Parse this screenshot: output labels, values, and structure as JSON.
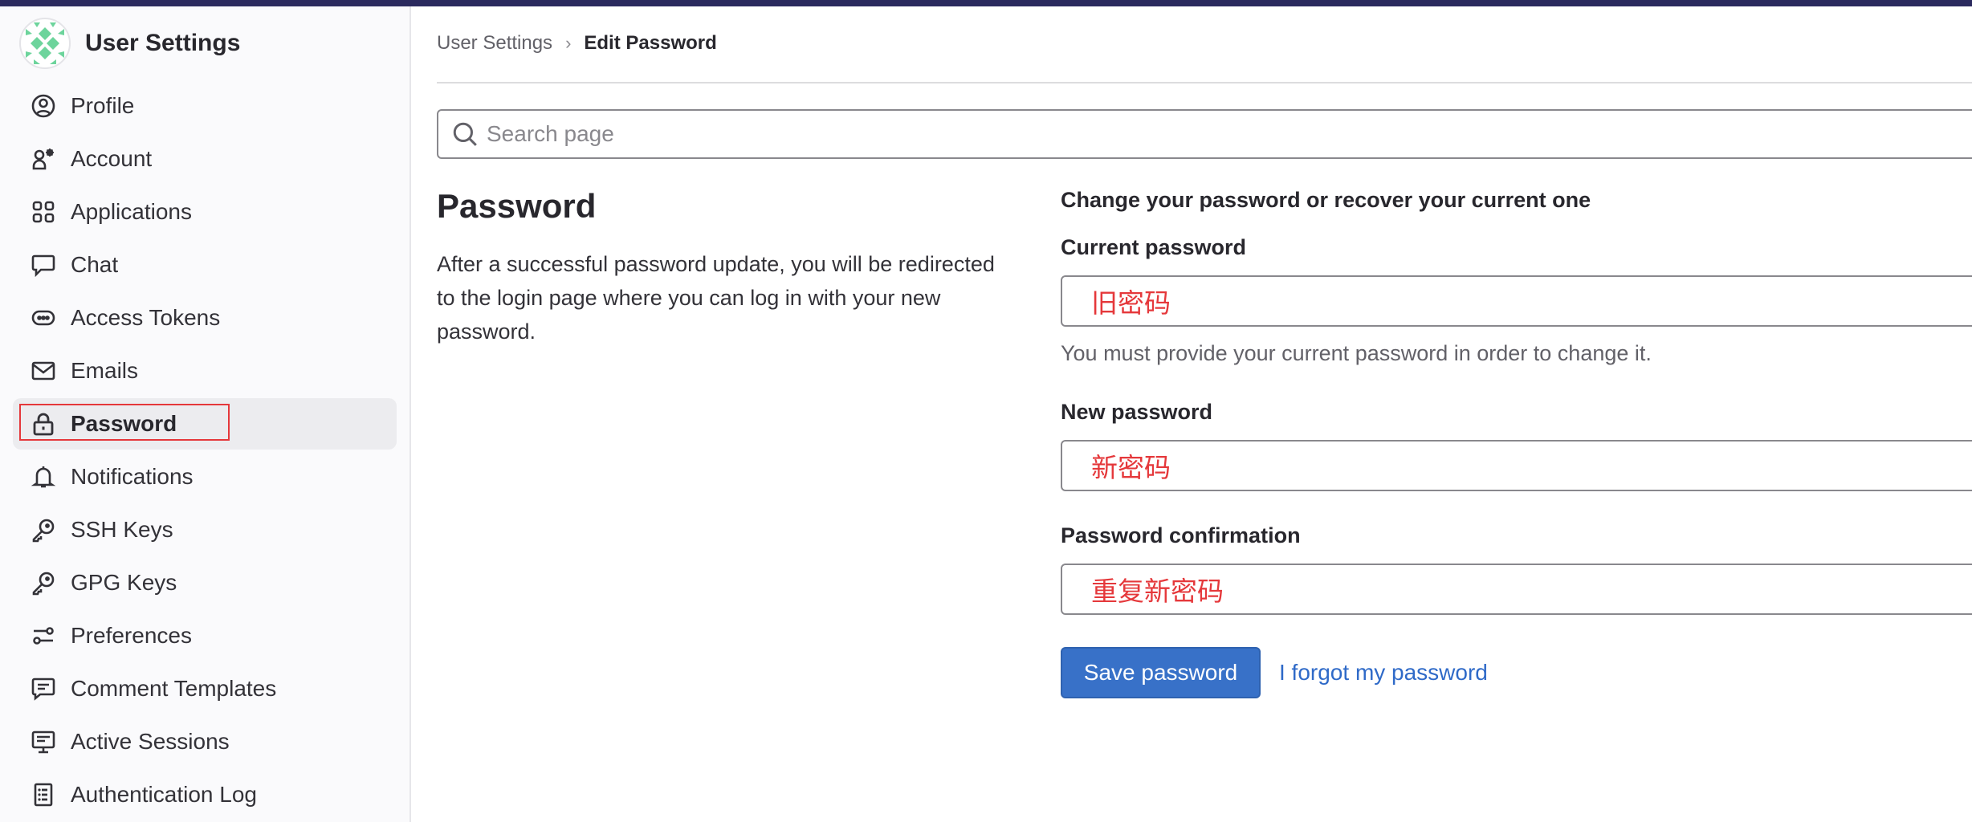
{
  "colors": {
    "topbar": "#2b2a5e",
    "accent": "#3871c8",
    "link": "#2f6ac8",
    "annotation_red": "#e5383b",
    "avatar_green": "#6dd49c"
  },
  "sidebar": {
    "title": "User Settings",
    "avatar_icon": "identicon-avatar",
    "items": [
      {
        "label": "Profile",
        "icon": "profile-icon",
        "active": false
      },
      {
        "label": "Account",
        "icon": "account-icon",
        "active": false
      },
      {
        "label": "Applications",
        "icon": "applications-icon",
        "active": false
      },
      {
        "label": "Chat",
        "icon": "chat-icon",
        "active": false
      },
      {
        "label": "Access Tokens",
        "icon": "token-icon",
        "active": false
      },
      {
        "label": "Emails",
        "icon": "mail-icon",
        "active": false
      },
      {
        "label": "Password",
        "icon": "lock-icon",
        "active": true
      },
      {
        "label": "Notifications",
        "icon": "bell-icon",
        "active": false
      },
      {
        "label": "SSH Keys",
        "icon": "key-icon",
        "active": false
      },
      {
        "label": "GPG Keys",
        "icon": "key-icon",
        "active": false
      },
      {
        "label": "Preferences",
        "icon": "preferences-icon",
        "active": false
      },
      {
        "label": "Comment Templates",
        "icon": "comment-template-icon",
        "active": false
      },
      {
        "label": "Active Sessions",
        "icon": "monitor-icon",
        "active": false
      },
      {
        "label": "Authentication Log",
        "icon": "log-icon",
        "active": false
      }
    ]
  },
  "breadcrumb": {
    "parent": "User Settings",
    "separator": "›",
    "current": "Edit Password"
  },
  "search": {
    "placeholder": "Search page",
    "value": ""
  },
  "section": {
    "title": "Password",
    "description": "After a successful password update, you will be redirected to the login page where you can log in with your new password."
  },
  "form": {
    "heading": "Change your password or recover your current one",
    "current_password": {
      "label": "Current password",
      "value": "旧密码",
      "help": "You must provide your current password in order to change it."
    },
    "new_password": {
      "label": "New password",
      "value": "新密码"
    },
    "password_confirmation": {
      "label": "Password confirmation",
      "value": "重复新密码"
    },
    "save_label": "Save password",
    "forgot_label": "I forgot my password"
  }
}
